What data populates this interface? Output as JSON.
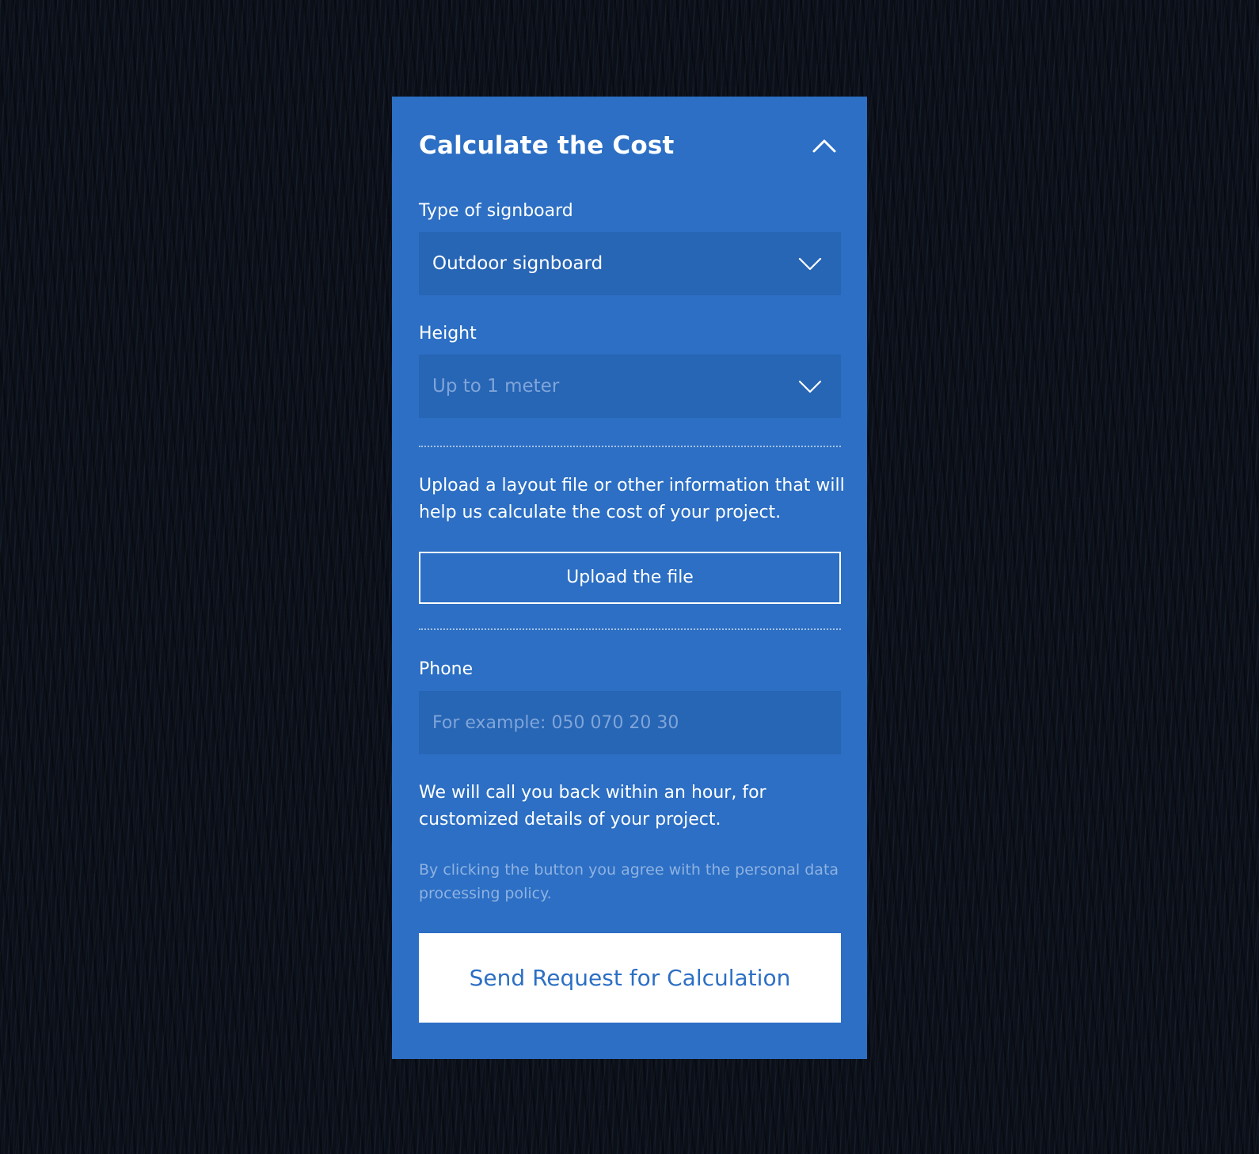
{
  "form": {
    "title": "Calculate the Cost",
    "collapse_icon": "chevron-up-icon",
    "signboard_type": {
      "label": "Type of signboard",
      "selected": "Outdoor signboard",
      "icon": "chevron-down-icon"
    },
    "height": {
      "label": "Height",
      "placeholder": "Up to 1 meter",
      "icon": "chevron-down-icon"
    },
    "upload": {
      "description": "Upload a layout file or other information that will help us calculate the cost of your project.",
      "button_label": "Upload the file"
    },
    "phone": {
      "label": "Phone",
      "value": "",
      "placeholder": "For example: 050 070 20 30"
    },
    "callback_note": "We will call you back within an hour, for customized details of your project.",
    "policy_note": "By clicking the button you agree with the personal data processing policy.",
    "submit_label": "Send Request for Calculation"
  },
  "colors": {
    "card_background": "#2c6fc4",
    "field_background": "#2765b5",
    "placeholder_text": "#7fa5d9",
    "page_background": "#0b0f18"
  }
}
